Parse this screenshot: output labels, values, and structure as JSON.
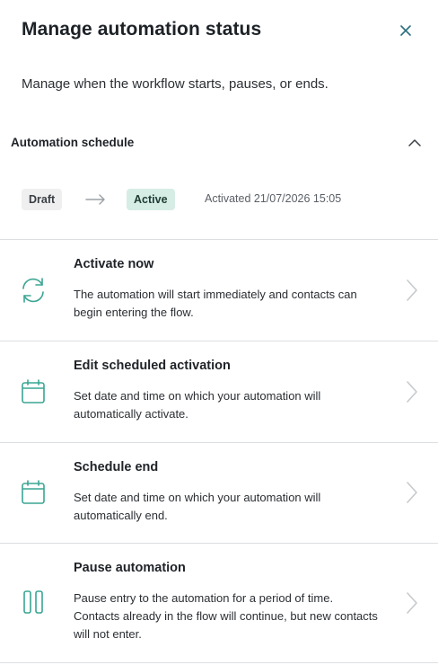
{
  "dialog": {
    "title": "Manage automation status",
    "description": "Manage when the workflow starts, pauses, or ends."
  },
  "schedule": {
    "label": "Automation schedule",
    "from_status": "Draft",
    "to_status": "Active",
    "activated_text": "Activated 21/07/2026 15:05"
  },
  "actions": [
    {
      "title": "Activate now",
      "description": "The automation will start immediately and contacts can begin entering the flow.",
      "icon": "refresh-icon"
    },
    {
      "title": "Edit scheduled activation",
      "description": "Set date and time on which your automation will automatically activate.",
      "icon": "calendar-icon"
    },
    {
      "title": "Schedule end",
      "description": "Set date and time on which your automation will automatically end.",
      "icon": "calendar-icon"
    },
    {
      "title": "Pause automation",
      "description": "Pause entry to the automation for a period of time. Contacts already in the flow will continue, but new contacts will not enter.",
      "icon": "pause-icon"
    }
  ],
  "colors": {
    "accent": "#3aa593",
    "active_badge_bg": "#d6ede6",
    "draft_badge_bg": "#efefef"
  }
}
